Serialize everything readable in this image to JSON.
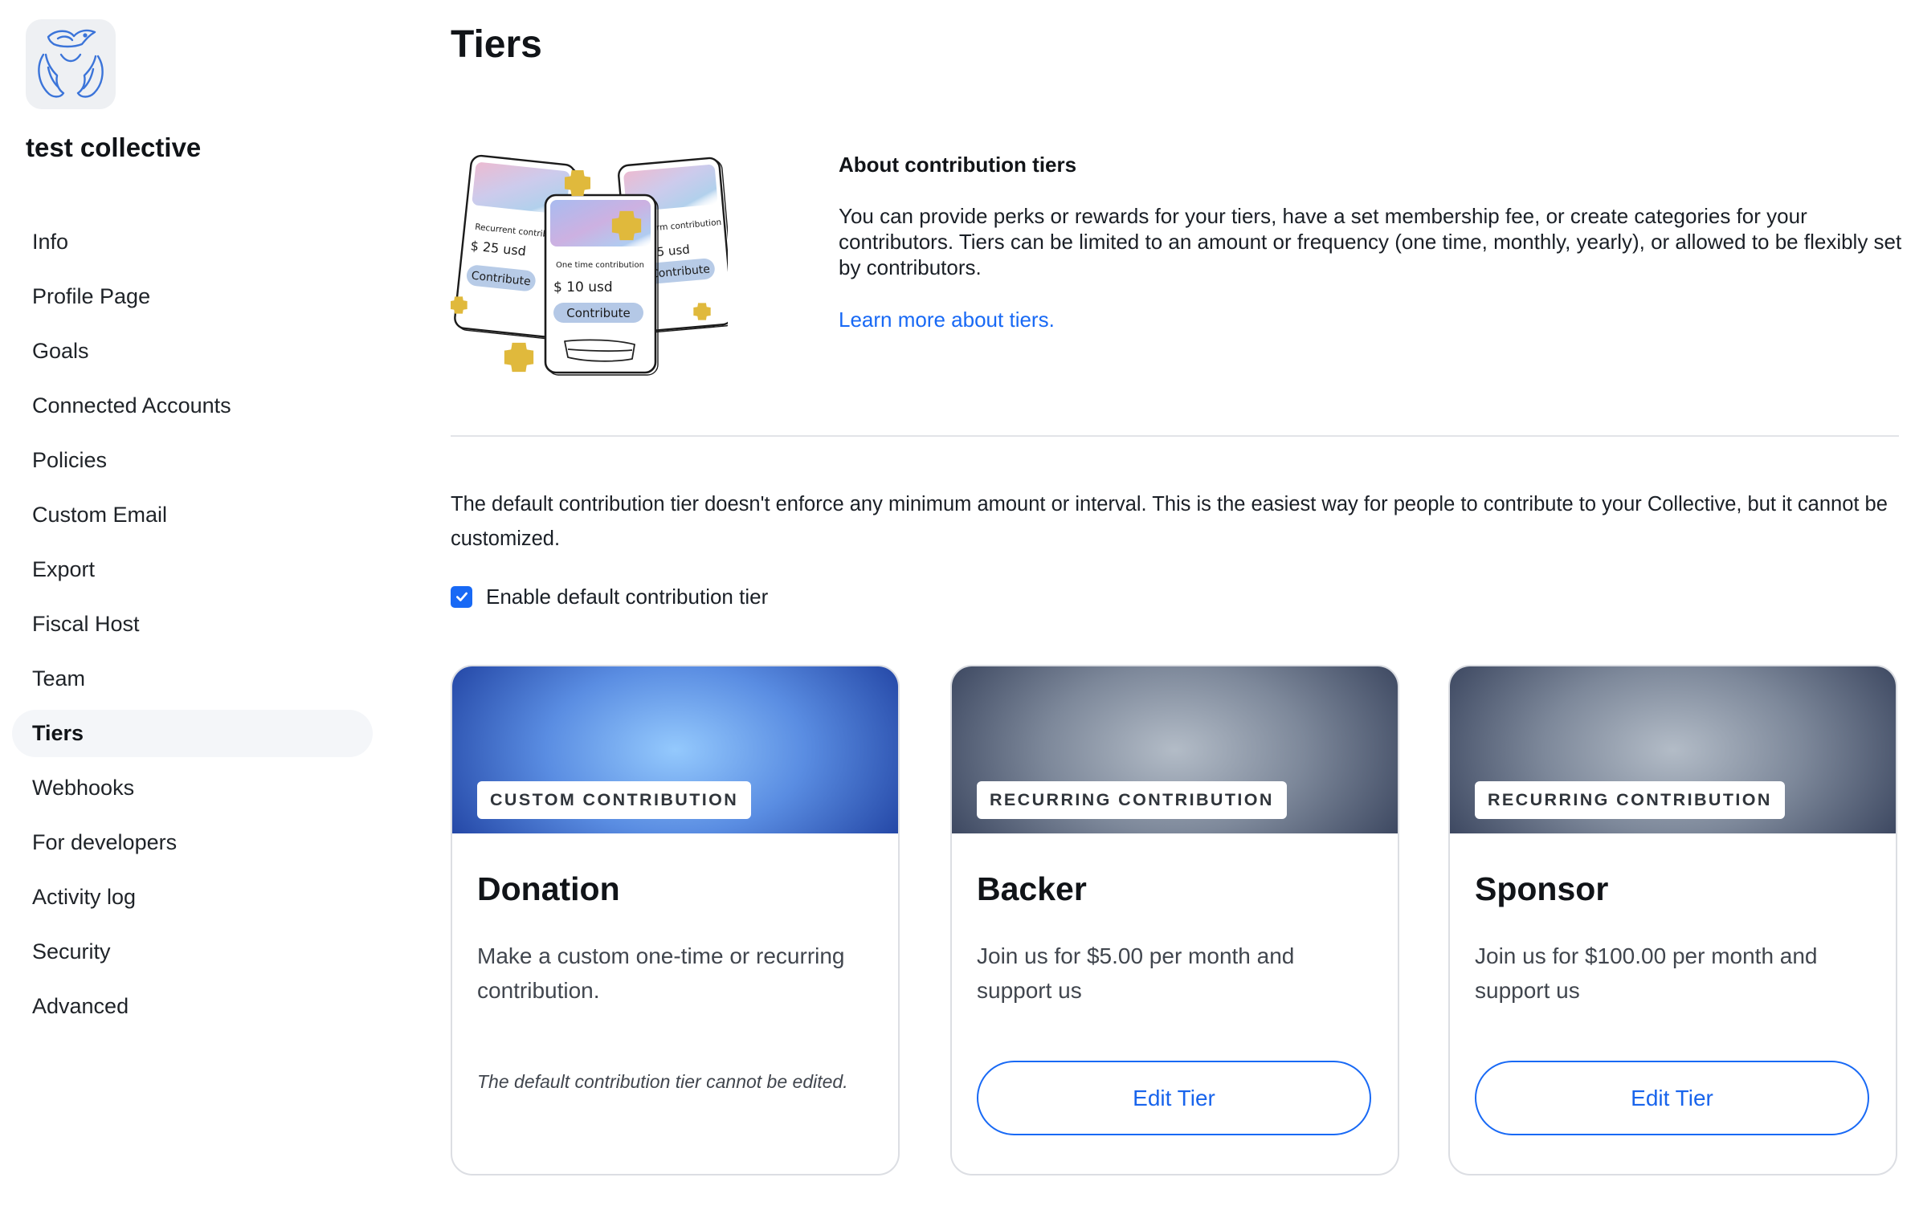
{
  "collective": {
    "name": "test collective",
    "logo_icon": "collective-logo-icon"
  },
  "sidebar": {
    "items": [
      {
        "label": "Info"
      },
      {
        "label": "Profile Page"
      },
      {
        "label": "Goals"
      },
      {
        "label": "Connected Accounts"
      },
      {
        "label": "Policies"
      },
      {
        "label": "Custom Email"
      },
      {
        "label": "Export"
      },
      {
        "label": "Fiscal Host"
      },
      {
        "label": "Team"
      },
      {
        "label": "Tiers",
        "active": true
      },
      {
        "label": "Webhooks"
      },
      {
        "label": "For developers"
      },
      {
        "label": "Activity log"
      },
      {
        "label": "Security"
      },
      {
        "label": "Advanced"
      }
    ]
  },
  "page": {
    "title": "Tiers"
  },
  "about": {
    "heading": "About contribution tiers",
    "body": "You can provide perks or rewards for your tiers, have a set membership fee, or create categories for your contributors. Tiers can be limited to an amount or frequency (one time, monthly, yearly), or allowed to be flexibly set by contributors.",
    "link": "Learn more about tiers."
  },
  "illustration": {
    "cards": [
      {
        "caption": "Recurrent contributi",
        "amount": "$ 25 usd",
        "button": "Contribute"
      },
      {
        "caption": "One time contribution",
        "amount": "$ 10 usd",
        "button": "Contribute"
      },
      {
        "caption": "rm contribution",
        "amount": "5 usd",
        "button": "Contribute"
      }
    ],
    "decoration_icon": "sparkle-icon"
  },
  "default_tier": {
    "description": "The default contribution tier doesn't enforce any minimum amount or interval. This is the easiest way for people to contribute to your Collective, but it cannot be customized.",
    "checkbox_label": "Enable default contribution tier",
    "checked": true,
    "checkbox_icon": "checkmark-icon"
  },
  "tiers": [
    {
      "type": "CUSTOM CONTRIBUTION",
      "name": "Donation",
      "description": "Make a custom one-time or recurring contribution.",
      "note": "The default contribution tier cannot be edited.",
      "header_colors": [
        "#94c9fd",
        "#5a8de2",
        "#2447a6"
      ]
    },
    {
      "type": "RECURRING CONTRIBUTION",
      "name": "Backer",
      "description": "Join us for $5.00 per month and support us",
      "button": "Edit Tier",
      "header_colors": [
        "#b3bcc7",
        "#7d889a",
        "#3d4861"
      ]
    },
    {
      "type": "RECURRING CONTRIBUTION",
      "name": "Sponsor",
      "description": "Join us for $100.00 per month and support us",
      "button": "Edit Tier",
      "header_colors": [
        "#b3bcc7",
        "#7d889a",
        "#3d4861"
      ]
    }
  ],
  "colors": {
    "primary": "#1869f5",
    "text": "#141a21",
    "muted": "#41464e",
    "border": "#dcdee3",
    "active_bg": "#f4f6f9",
    "divider": "#e2e4e8"
  }
}
